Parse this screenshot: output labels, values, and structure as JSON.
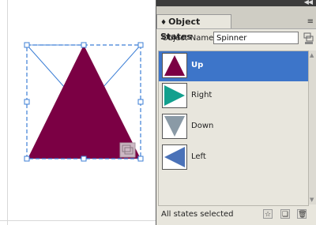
{
  "panel": {
    "tab_label": "Object States",
    "tab_arrows": "♦",
    "collapse": "◀◀",
    "menu_icon": "≡",
    "object_name_label": "Object Name:",
    "object_name_value": "Spinner"
  },
  "states": [
    {
      "label": "Up",
      "shape": "triangle-up",
      "color": "#7b0044",
      "selected": true
    },
    {
      "label": "Right",
      "shape": "triangle-right",
      "color": "#12a08e",
      "selected": false
    },
    {
      "label": "Down",
      "shape": "triangle-down",
      "color": "#8a9aa6",
      "selected": false
    },
    {
      "label": "Left",
      "shape": "triangle-left",
      "color": "#4a72b8",
      "selected": false
    }
  ],
  "footer": {
    "status": "All states selected"
  },
  "canvas": {
    "triangle_color": "#7b0044",
    "selection_color": "#3d7fd6"
  }
}
